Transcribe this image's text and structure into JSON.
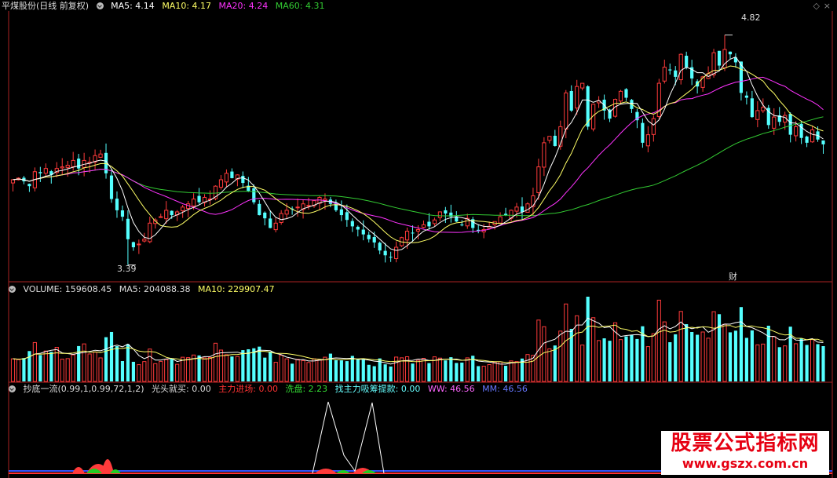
{
  "colors": {
    "background": "#000000",
    "up": "#ff3b3b",
    "down": "#54ffff",
    "ma5": "#ffffff",
    "ma10": "#ffff66",
    "ma20": "#ff33ff",
    "ma60": "#33cc33",
    "divider": "#aa2222"
  },
  "price_panel": {
    "title": "平煤股份(日线 前复权)",
    "ma5_label": "MA5: 4.14",
    "ma10_label": "MA10: 4.17",
    "ma20_label": "MA20: 4.24",
    "ma60_label": "MA60: 4.31",
    "high_label": "4.82",
    "low_label": "3.39",
    "finance_marker": "财",
    "collapse_icon": "circle-chevron-icon"
  },
  "volume_panel": {
    "volume_label": "VOLUME: 159608.45",
    "ma5_label": "MA5: 204088.38",
    "ma10_label": "MA10: 229907.47"
  },
  "indicator_panel": {
    "name_label": "抄底一流(0.99,1,0.99,72,1,2)",
    "buy_label": "光头就买: 0.00",
    "main_enter_label": "主力进场: 0.00",
    "wash_label": "洗盘: 2.23",
    "absorb_label": "找主力吸筹提款: 0.00",
    "ww_label": "WW: 46.56",
    "mm_label": "MM: 46.56"
  },
  "watermark": {
    "title": "股票公式指标网",
    "url": "www.gszx.com.cn"
  },
  "chart_data": {
    "type": "candlestick",
    "price_range": [
      3.3,
      4.95
    ],
    "high": 4.82,
    "low": 3.39,
    "closes": [
      3.92,
      3.93,
      3.91,
      3.88,
      3.97,
      3.96,
      3.99,
      3.95,
      3.99,
      4.0,
      4.01,
      4.04,
      3.99,
      4.04,
      4.03,
      4.07,
      4.08,
      3.96,
      3.8,
      3.73,
      3.69,
      3.55,
      3.5,
      3.52,
      3.55,
      3.65,
      3.67,
      3.69,
      3.73,
      3.7,
      3.72,
      3.75,
      3.77,
      3.8,
      3.78,
      3.81,
      3.8,
      3.88,
      3.92,
      3.96,
      3.93,
      3.95,
      3.9,
      3.85,
      3.78,
      3.7,
      3.68,
      3.62,
      3.65,
      3.71,
      3.73,
      3.74,
      3.75,
      3.77,
      3.76,
      3.79,
      3.81,
      3.8,
      3.77,
      3.73,
      3.7,
      3.67,
      3.63,
      3.61,
      3.58,
      3.55,
      3.53,
      3.48,
      3.45,
      3.44,
      3.5,
      3.56,
      3.6,
      3.59,
      3.61,
      3.64,
      3.63,
      3.67,
      3.72,
      3.71,
      3.69,
      3.66,
      3.64,
      3.68,
      3.62,
      3.6,
      3.61,
      3.63,
      3.66,
      3.69,
      3.7,
      3.73,
      3.75,
      3.72,
      3.77,
      3.82,
      4.0,
      4.15,
      4.19,
      4.13,
      4.25,
      4.46,
      4.35,
      4.5,
      4.52,
      4.25,
      4.39,
      4.41,
      4.35,
      4.3,
      4.42,
      4.47,
      4.43,
      4.36,
      4.29,
      4.15,
      4.2,
      4.3,
      4.52,
      4.62,
      4.6,
      4.56,
      4.7,
      4.62,
      4.55,
      4.5,
      4.56,
      4.58,
      4.71,
      4.63,
      4.73,
      4.7,
      4.65,
      4.46,
      4.43,
      4.31,
      4.35,
      4.37,
      4.26,
      4.31,
      4.28,
      4.32,
      4.2,
      4.25,
      4.18,
      4.15,
      4.23,
      4.17,
      4.14
    ],
    "ma5": [
      4.14
    ],
    "ma10": [
      4.17
    ],
    "ma20": [
      4.24
    ],
    "ma60": [
      4.31
    ],
    "volume": {
      "last": 159608.45,
      "ma5": 204088.38,
      "ma10": 229907.47
    }
  }
}
